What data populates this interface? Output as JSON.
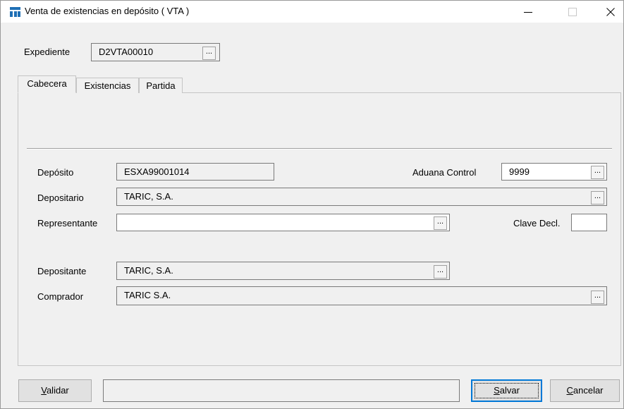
{
  "window": {
    "title": "Venta de existencias en depósito ( VTA )",
    "icons": {
      "app": "taric-app-icon",
      "minimize": "minimize-icon",
      "maximize": "maximize-icon",
      "close": "close-icon"
    }
  },
  "expediente": {
    "label": "Expediente",
    "value": "D2VTA00010",
    "browse": "..."
  },
  "tabs": [
    {
      "label": "Cabecera"
    },
    {
      "label": "Existencias"
    },
    {
      "label": "Partida"
    }
  ],
  "form": {
    "deposito": {
      "label": "Depósito",
      "value": "ESXA99001014"
    },
    "aduana_control": {
      "label": "Aduana Control",
      "value": "9999",
      "browse": "..."
    },
    "depositario": {
      "label": "Depositario",
      "value": "TARIC, S.A.",
      "browse": "..."
    },
    "representante": {
      "label": "Representante",
      "value": "",
      "browse": "..."
    },
    "clave_decl": {
      "label": "Clave Decl.",
      "value": ""
    },
    "depositante": {
      "label": "Depositante",
      "value": "TARIC, S.A.",
      "browse": "..."
    },
    "comprador": {
      "label": "Comprador",
      "value": "TARIC S.A.",
      "browse": "..."
    }
  },
  "footer": {
    "validar": {
      "mnemonic": "V",
      "rest": "alidar"
    },
    "status": "",
    "salvar": {
      "mnemonic": "S",
      "rest": "alvar"
    },
    "cancelar": {
      "mnemonic": "C",
      "rest": "ancelar"
    }
  }
}
